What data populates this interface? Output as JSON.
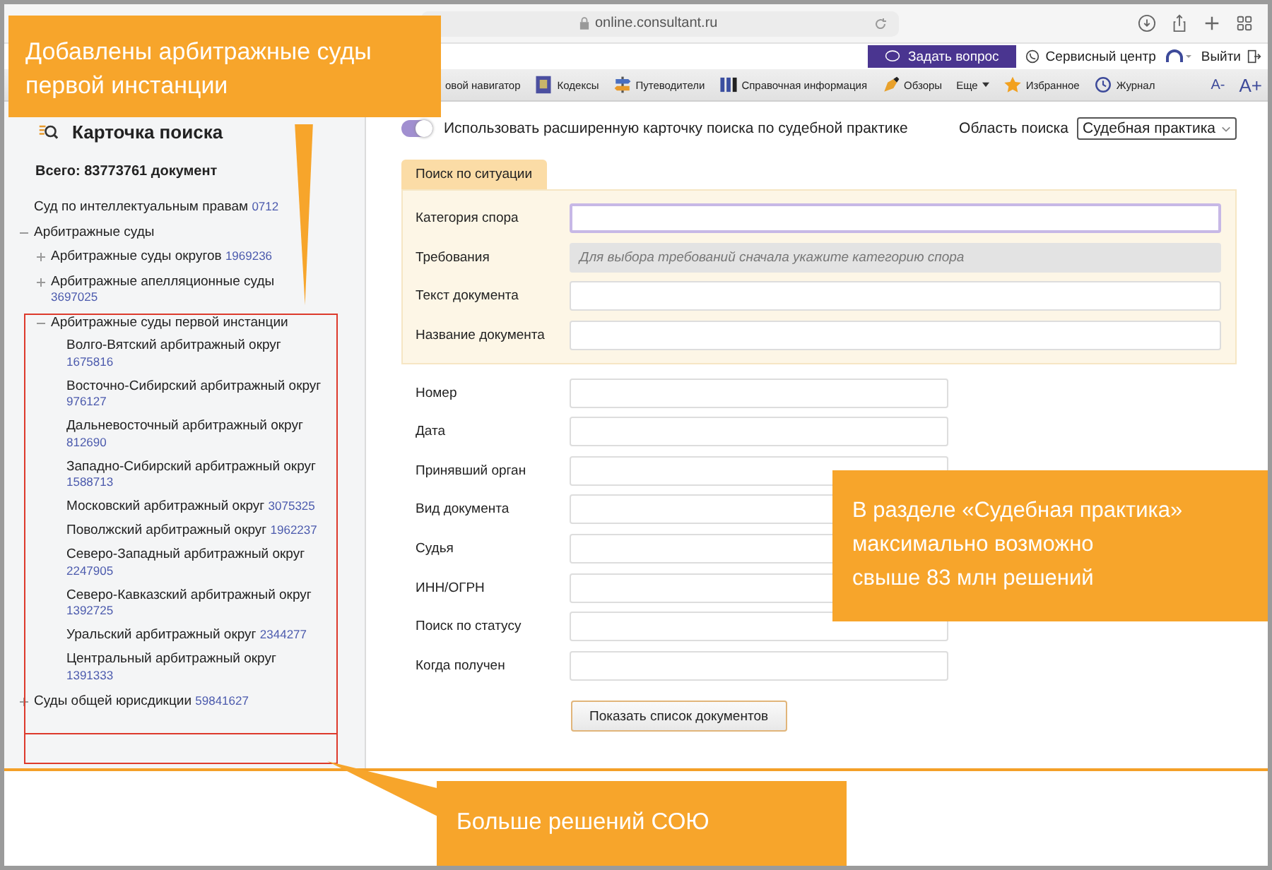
{
  "browser": {
    "url": "online.consultant.ru"
  },
  "header": {
    "ask_button": "Задать вопрос",
    "service_center": "Сервисный центр",
    "logout": "Выйти"
  },
  "toolbar": {
    "items": [
      {
        "label": "овой навигатор",
        "kind": "plain"
      },
      {
        "label": "Кодексы",
        "kind": "book"
      },
      {
        "label": "Путеводители",
        "kind": "signs"
      },
      {
        "label": "Справочная информация",
        "kind": "binders"
      },
      {
        "label": "Обзоры",
        "kind": "pen"
      },
      {
        "label": "Еще",
        "kind": "menu"
      },
      {
        "label": "Избранное",
        "kind": "star"
      },
      {
        "label": "Журнал",
        "kind": "clock"
      }
    ],
    "font_smaller": "A-",
    "font_larger": "A+"
  },
  "sidebar": {
    "title": "Карточка поиска",
    "total": "Всего: 83773761 документ",
    "tree": [
      {
        "label": "Суд по интеллектуальным правам",
        "count": "0712"
      },
      {
        "label": "Арбитражные суды",
        "expanded": true,
        "children": [
          {
            "label": "Арбитражные суды округов",
            "count": "1969236",
            "expanded": false
          },
          {
            "label": "Арбитражные апелляционные суды",
            "count": "3697025",
            "expanded": false
          },
          {
            "label": "Арбитражные суды первой инстанции",
            "expanded": true,
            "children": [
              {
                "label": "Волго-Вятский арбитражный округ",
                "count": "1675816"
              },
              {
                "label": "Восточно-Сибирский арбитражный округ",
                "count": "976127"
              },
              {
                "label": "Дальневосточный арбитражный округ",
                "count": "812690"
              },
              {
                "label": "Западно-Сибирский арбитражный округ",
                "count": "1588713"
              },
              {
                "label": "Московский арбитражный округ",
                "count": "3075325"
              },
              {
                "label": "Поволжский арбитражный округ",
                "count": "1962237"
              },
              {
                "label": "Северо-Западный арбитражный округ",
                "count": "2247905"
              },
              {
                "label": "Северо-Кавказский арбитражный округ",
                "count": "1392725"
              },
              {
                "label": "Уральский арбитражный округ",
                "count": "2344277"
              },
              {
                "label": "Центральный арбитражный округ",
                "count": "1391333"
              }
            ]
          }
        ]
      },
      {
        "label": "Суды общей юрисдикции",
        "count": "59841627",
        "expanded": false
      }
    ]
  },
  "main": {
    "toggle": {
      "label": "Использовать расширенную карточку поиска по судебной практике",
      "on": true
    },
    "search_area": {
      "label": "Область поиска",
      "value": "Судебная практика"
    },
    "tabs": [
      {
        "label": "Поиск по ситуации",
        "selected": true
      }
    ],
    "situation_fields": [
      {
        "label": "Категория спора",
        "focused": true,
        "disabled": false
      },
      {
        "label": "Требования",
        "placeholder": "Для выбора требований сначала укажите категорию спора",
        "focused": false,
        "disabled": true
      },
      {
        "label": "Текст документа",
        "focused": false,
        "disabled": false
      },
      {
        "label": "Название документа",
        "focused": false,
        "disabled": false
      }
    ],
    "fields": [
      {
        "label": "Номер"
      },
      {
        "label": "Дата"
      },
      {
        "label": "Принявший орган"
      },
      {
        "label": "Вид документа"
      },
      {
        "label": "Судья"
      },
      {
        "label": "ИНН/ОГРН"
      },
      {
        "label": "Поиск по статусу"
      },
      {
        "label": "Когда получен"
      }
    ],
    "submit_button": "Показать список документов"
  },
  "callouts": [
    {
      "text": "Добавлены арбитражные суды первой инстанции"
    },
    {
      "text": "В разделе «Судебная практика»\nмаксимально возможно\nсвыше 83 млн решений"
    },
    {
      "text": "Больше решений СОЮ"
    }
  ]
}
